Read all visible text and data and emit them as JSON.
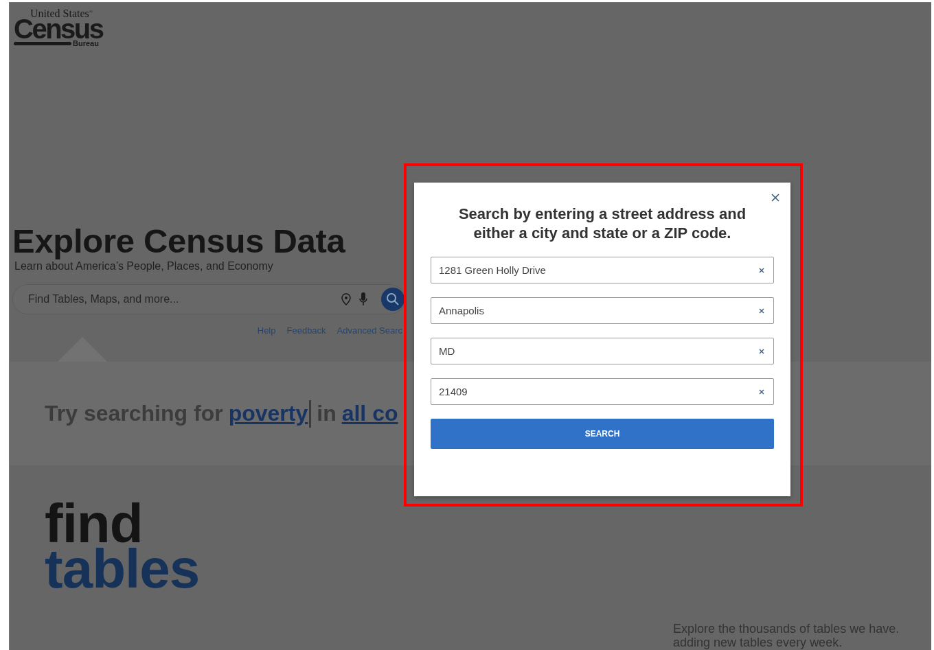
{
  "logo": {
    "top": "United States$^{®}$",
    "main": "Census",
    "bottom": "Bureau"
  },
  "hero": {
    "title": "Explore Census Data",
    "subtitle": "Learn about America’s People, Places, and Economy"
  },
  "search": {
    "placeholder": "Find Tables, Maps, and more..."
  },
  "search_links": [
    "Help",
    "Feedback",
    "Advanced Searc"
  ],
  "suggestion": {
    "prefix": "Try searching for",
    "topic": "poverty",
    "middle": "in",
    "scope": "all co"
  },
  "find": {
    "line1": "find",
    "line2": "tables",
    "description": [
      "Explore the thousands of tables we have.",
      "adding new tables every week."
    ]
  },
  "modal": {
    "highlighted": true,
    "title": "Search by entering a street address and either a city and state or a ZIP code.",
    "fields": [
      {
        "value": "1281 Green Holly Drive"
      },
      {
        "value": "Annapolis"
      },
      {
        "value": "MD"
      },
      {
        "value": "21409"
      }
    ],
    "button": "SEARCH"
  }
}
